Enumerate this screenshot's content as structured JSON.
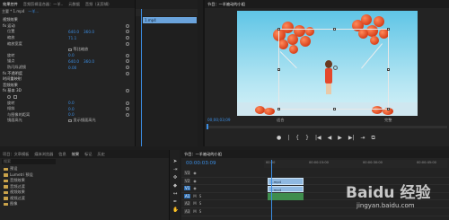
{
  "effect_controls": {
    "tabs": [
      "效果控件",
      "音频剪辑混合器：一羊..",
      "元数据",
      "音频（无剪辑）"
    ],
    "clip_header": [
      "主要 * 1.mp4",
      "一羊..."
    ],
    "section": "视频效果",
    "motion": "fx 运动",
    "rows": [
      {
        "label": "位置",
        "v1": "640.0",
        "v2": "360.0"
      },
      {
        "label": "缩放",
        "v1": "71.1",
        "v2": ""
      },
      {
        "label": "缩放宽度",
        "v1": "",
        "v2": ""
      },
      {
        "label": "",
        "check": "等比缩放"
      },
      {
        "label": "旋转",
        "v1": "0.0",
        "v2": ""
      },
      {
        "label": "锚点",
        "v1": "640.0",
        "v2": "360.0"
      },
      {
        "label": "防闪烁滤镜",
        "v1": "0.00",
        "v2": ""
      }
    ],
    "opacity": "fx 不透明度",
    "time_remap": "时间重映射",
    "audio_section": "音频效果",
    "fx2": "fx 基本 3D",
    "rows2": [
      {
        "label": "旋转",
        "v1": "0.0",
        "v2": ""
      },
      {
        "label": "倾斜",
        "v1": "0.0",
        "v2": ""
      },
      {
        "label": "与图像的距离",
        "v1": "0.0",
        "v2": ""
      },
      {
        "label": "镜面高光",
        "check": "显示镜面高光"
      }
    ]
  },
  "mini_timeline": {
    "clip_name": "1.mp4"
  },
  "program": {
    "tab": "节目：一羊被动的小姐",
    "timecode": "00;00;03;09",
    "fit": "适合",
    "quality": "完整",
    "transport": [
      "●",
      "|",
      "{",
      "}",
      "|◀",
      "◀",
      "▶",
      "▶|",
      "⇥",
      "⧉"
    ]
  },
  "project": {
    "tabs": [
      "项目：文章模板",
      "媒体浏览器",
      "信息",
      "效果",
      "标记",
      "历史"
    ],
    "search_placeholder": "搜索",
    "items": [
      "预设",
      "Lumetri 预设",
      "音频效果",
      "音频过渡",
      "视频效果",
      "视频过渡",
      "图像"
    ]
  },
  "timeline": {
    "timecode": "00:00:03:09",
    "ruler": [
      "00:00",
      "00:00:15:00",
      "00:00:30:00",
      "00:00:45:00"
    ],
    "tracks": [
      {
        "name": "V3",
        "clip": ""
      },
      {
        "name": "V2",
        "clip": "1.mp4"
      },
      {
        "name": "V1",
        "clip": "1.mp4"
      },
      {
        "name": "A1",
        "clip": ""
      },
      {
        "name": "A2",
        "clip": ""
      },
      {
        "name": "A3",
        "clip": ""
      }
    ]
  },
  "watermark": "Baidu 经验",
  "watermark_url": "jingyan.baidu.com"
}
